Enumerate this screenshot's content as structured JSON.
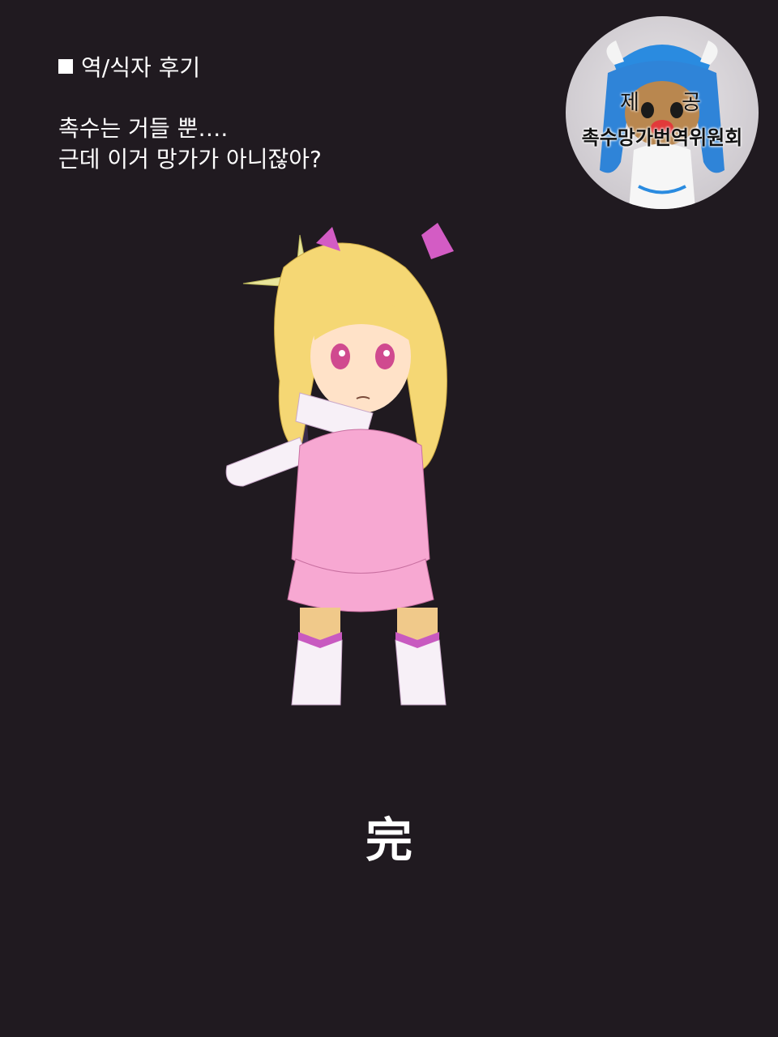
{
  "heading": {
    "icon": "black-square-icon",
    "text": "역/식자 후기"
  },
  "notes": [
    "촉수는 거들 뿐….",
    "근데 이거 망가가 아니잖아?"
  ],
  "badge": {
    "top_text": "제 공",
    "bottom_text": "촉수망가번역위원회",
    "image": "squid-girl-figure"
  },
  "illustration": "magical-girl-with-staff",
  "end_mark": "完",
  "colors": {
    "background": "#201a20",
    "text": "#ffffff",
    "dress": "#f7a8d2",
    "hair": "#f5d774"
  }
}
